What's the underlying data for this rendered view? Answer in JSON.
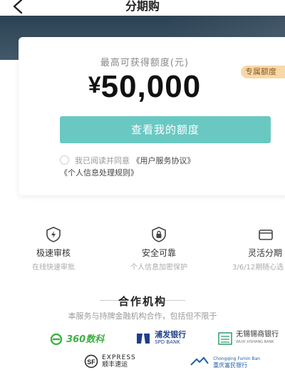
{
  "nav": {
    "title": "分期购"
  },
  "card": {
    "quota_label": "最高可获得额度(元)",
    "badge": "专属额度",
    "currency": "¥",
    "amount": "50,000",
    "cta": "查看我的额度",
    "agree_prefix": "我已阅读并同意",
    "agree_link1": "《用户服务协议》",
    "agree_link2": "《个人信息处理规则》"
  },
  "features": [
    {
      "title": "极速审核",
      "sub": "在线快速审批",
      "icon": "lightning-shield-icon"
    },
    {
      "title": "安全可靠",
      "sub": "个人信息加密保护",
      "icon": "lock-shield-icon"
    },
    {
      "title": "灵活分期",
      "sub": "3/6/12期随心选",
      "icon": "card-icon"
    }
  ],
  "partners": {
    "title": "合作机构",
    "subtitle": "本服务与持牌金融机构合作，包括但不限于",
    "logos": [
      {
        "name": "360数科",
        "color": "#3cb043"
      },
      {
        "name": "浦发银行",
        "sub": "SPD BANK",
        "color": "#1e3f8a"
      },
      {
        "name": "无锡锡商银行",
        "sub": "WUXI XISHANG BANK",
        "color": "#2a9d6a"
      },
      {
        "name": "EXPRESS",
        "sub": "顺丰速运",
        "color": "#222222"
      },
      {
        "name": "Chongqing Fumin Ban",
        "sub": "重庆富民银行",
        "color": "#1d5fa8"
      }
    ]
  },
  "colors": {
    "accent": "#6ac8c2",
    "hero": "#2c4254",
    "badge_bg": "#f8d8a8",
    "badge_text": "#8b5a1e"
  }
}
